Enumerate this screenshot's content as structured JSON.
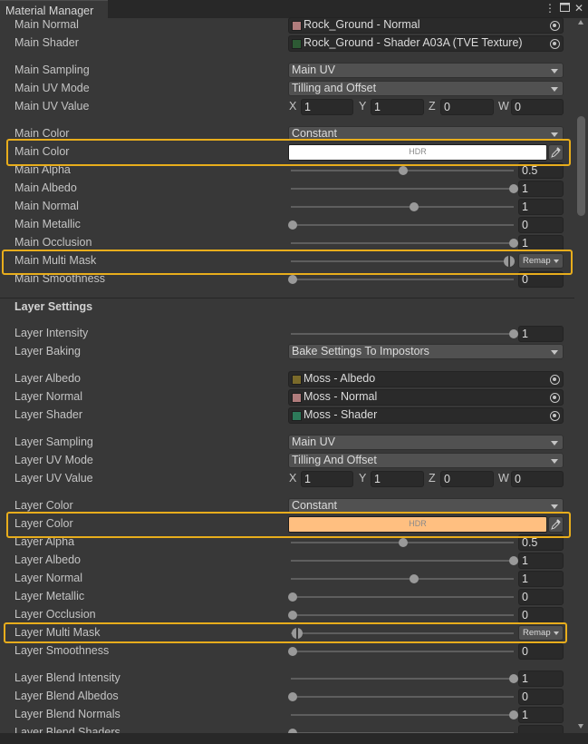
{
  "window": {
    "tab_title": "Material Manager"
  },
  "main": {
    "normal": {
      "label": "Main Normal",
      "value": "Rock_Ground - Normal",
      "thumb": "#b07c7c"
    },
    "shader": {
      "label": "Main Shader",
      "value": "Rock_Ground - Shader A03A (TVE Texture)",
      "thumb": "#2d5a34"
    },
    "sampling": {
      "label": "Main Sampling",
      "value": "Main UV"
    },
    "uv_mode": {
      "label": "Main UV Mode",
      "value": "Tilling and Offset"
    },
    "uv_value": {
      "label": "Main UV Value",
      "x_label": "X",
      "x": "1",
      "y_label": "Y",
      "y": "1",
      "z_label": "Z",
      "z": "0",
      "w_label": "W",
      "w": "0"
    },
    "color_mode": {
      "label": "Main Color",
      "value": "Constant"
    },
    "color": {
      "label": "Main Color",
      "hdr": "HDR",
      "swatch": "#ffffff"
    },
    "alpha": {
      "label": "Main Alpha",
      "value": "0.5",
      "fraction": 0.5
    },
    "albedo": {
      "label": "Main Albedo",
      "value": "1",
      "fraction": 1
    },
    "normal_slider": {
      "label": "Main Normal",
      "value": "1",
      "fraction": 0.55
    },
    "metallic": {
      "label": "Main Metallic",
      "value": "0",
      "fraction": 0
    },
    "occlusion": {
      "label": "Main Occlusion",
      "value": "1",
      "fraction": 1
    },
    "multi_mask": {
      "label": "Main Multi Mask",
      "remap": "Remap",
      "min": 0.98,
      "max": 1.0
    },
    "smoothness": {
      "label": "Main Smoothness",
      "value": "0",
      "fraction": 0
    }
  },
  "layer": {
    "section_title": "Layer Settings",
    "intensity": {
      "label": "Layer Intensity",
      "value": "1",
      "fraction": 1
    },
    "baking": {
      "label": "Layer Baking",
      "value": "Bake Settings To Impostors"
    },
    "albedo_tex": {
      "label": "Layer Albedo",
      "value": "Moss - Albedo",
      "thumb": "#7a6a2a"
    },
    "normal_tex": {
      "label": "Layer Normal",
      "value": "Moss - Normal",
      "thumb": "#b07c7c"
    },
    "shader_tex": {
      "label": "Layer Shader",
      "value": "Moss - Shader",
      "thumb": "#2d7a5a"
    },
    "sampling": {
      "label": "Layer Sampling",
      "value": "Main UV"
    },
    "uv_mode": {
      "label": "Layer UV Mode",
      "value": "Tilling And Offset"
    },
    "uv_value": {
      "label": "Layer UV Value",
      "x_label": "X",
      "x": "1",
      "y_label": "Y",
      "y": "1",
      "z_label": "Z",
      "z": "0",
      "w_label": "W",
      "w": "0"
    },
    "color_mode": {
      "label": "Layer Color",
      "value": "Constant"
    },
    "color": {
      "label": "Layer Color",
      "hdr": "HDR",
      "swatch": "#ffbf80"
    },
    "alpha": {
      "label": "Layer Alpha",
      "value": "0.5",
      "fraction": 0.5
    },
    "albedo": {
      "label": "Layer Albedo",
      "value": "1",
      "fraction": 1
    },
    "normal": {
      "label": "Layer Normal",
      "value": "1",
      "fraction": 0.55
    },
    "metallic": {
      "label": "Layer Metallic",
      "value": "0",
      "fraction": 0
    },
    "occlusion": {
      "label": "Layer Occlusion",
      "value": "0",
      "fraction": 0
    },
    "multi_mask": {
      "label": "Layer Multi Mask",
      "remap": "Remap",
      "min": 0.0,
      "max": 0.02
    },
    "smoothness": {
      "label": "Layer Smoothness",
      "value": "0",
      "fraction": 0
    },
    "blend_intensity": {
      "label": "Layer Blend Intensity",
      "value": "1",
      "fraction": 1
    },
    "blend_albedos": {
      "label": "Layer Blend Albedos",
      "value": "0",
      "fraction": 0
    },
    "blend_normals": {
      "label": "Layer Blend Normals",
      "value": "1",
      "fraction": 1
    },
    "blend_shaders": {
      "label": "Layer Blend Shaders",
      "value": "",
      "fraction": 0
    }
  },
  "icons": [
    "kebab-menu-icon",
    "maximize-icon",
    "close-icon",
    "object-picker-icon",
    "eyedropper-icon",
    "dropdown-arrow-icon"
  ],
  "colors": {
    "highlight": "#e8ad1c",
    "background": "#383838"
  }
}
